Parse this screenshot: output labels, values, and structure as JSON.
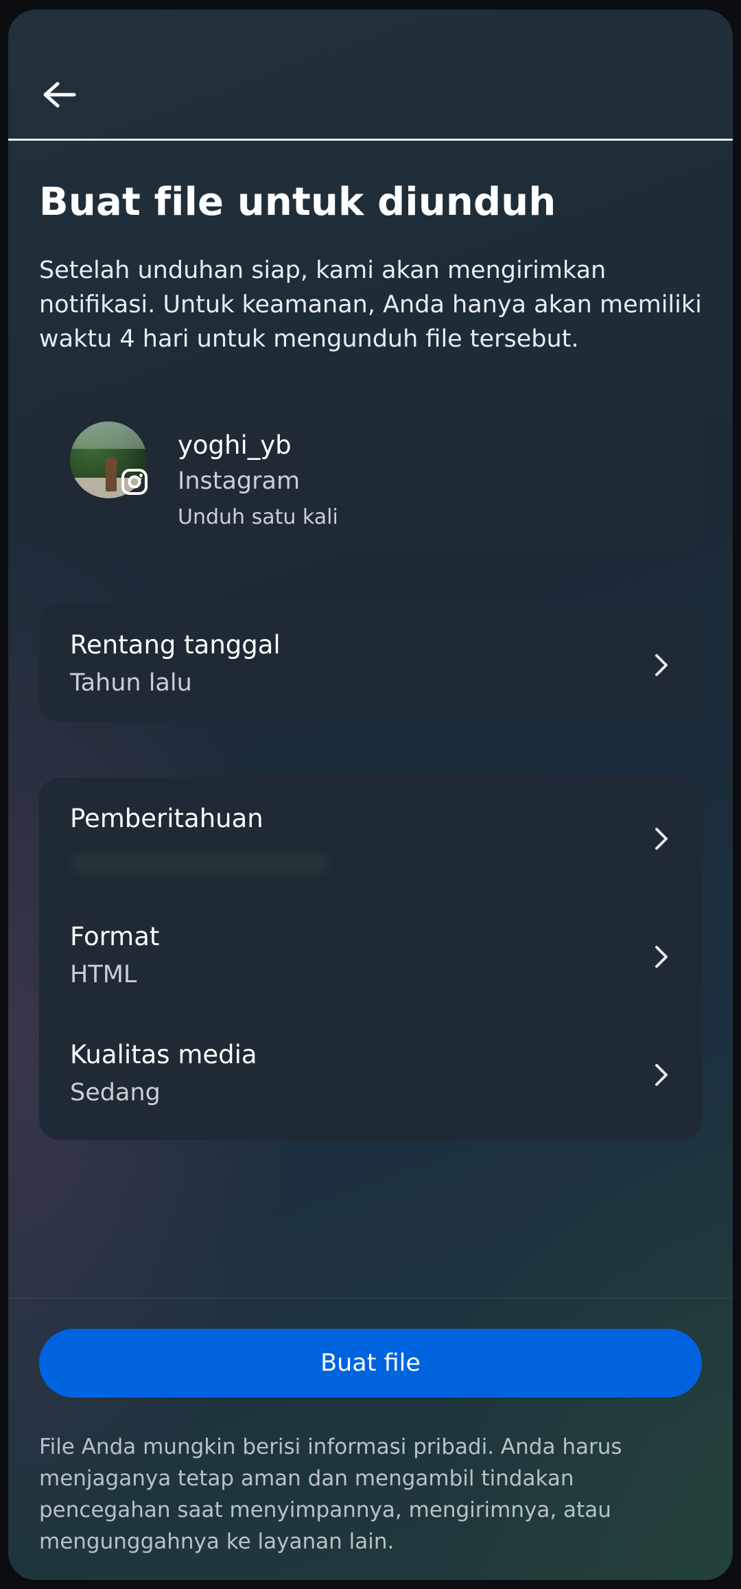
{
  "header": {
    "back_icon": "arrow-left-icon"
  },
  "page": {
    "title": "Buat file untuk diunduh",
    "description": "Setelah unduhan siap, kami akan mengirimkan notifikasi. Untuk keamanan, Anda hanya akan memiliki waktu 4 hari untuk mengunduh file tersebut."
  },
  "account": {
    "username": "yoghi_yb",
    "platform": "Instagram",
    "frequency": "Unduh satu kali",
    "badge_icon": "instagram-icon"
  },
  "date_range": {
    "label": "Rentang tanggal",
    "value": "Tahun lalu"
  },
  "options": [
    {
      "label": "Pemberitahuan",
      "value": ""
    },
    {
      "label": "Format",
      "value": "HTML"
    },
    {
      "label": "Kualitas media",
      "value": "Sedang"
    }
  ],
  "actions": {
    "create_label": "Buat file"
  },
  "disclaimer": "File Anda mungkin berisi informasi pribadi. Anda harus menjaganya tetap aman dan mengambil tindakan pencegahan saat menyimpannya, mengirimnya, atau mengunggahnya ke layanan lain.",
  "colors": {
    "accent": "#0064e0",
    "card": "#1f2a34",
    "text_primary": "#ffffff",
    "text_secondary": "#c9d0d6"
  }
}
